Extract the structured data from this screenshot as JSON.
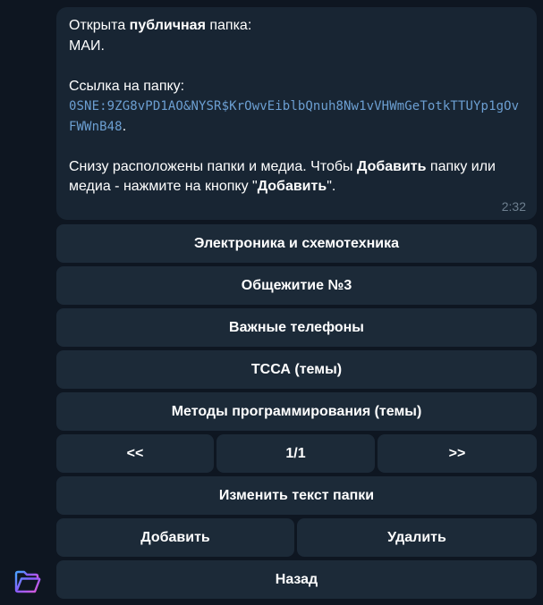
{
  "message": {
    "line1_pre": "Открыта ",
    "line1_bold": "публичная",
    "line1_post": " папка:",
    "folder_name": "МАИ.",
    "link_label": "Ссылка на папку:",
    "link_code": "0SNE:9ZG8vPD1AO&NYSR$KrOwvEiblbQnuh8Nw1vVHWmGeTotkTTUYp1gOvFWWnB48",
    "link_end": ".",
    "info_pre": "Снизу расположены папки и медиа. Чтобы ",
    "info_bold1": "Добавить",
    "info_mid": " папку или медиа - нажмите на кнопку \"",
    "info_bold2": "Добавить",
    "info_post": "\".",
    "time": "2:32"
  },
  "keyboard": {
    "folders": [
      "Электроника и схемотехника",
      "Общежитие №3",
      "Важные телефоны",
      "ТССА (темы)",
      "Методы программирования (темы)"
    ],
    "prev": "<<",
    "page": "1/1",
    "next": ">>",
    "edit": "Изменить текст папки",
    "add": "Добавить",
    "delete": "Удалить",
    "back": "Назад"
  },
  "icons": {
    "avatar": "folder-icon",
    "accent": "#6c9fd2",
    "bubble_bg": "#182533",
    "button_bg": "#1c2a38",
    "page_bg": "#0e1621"
  }
}
